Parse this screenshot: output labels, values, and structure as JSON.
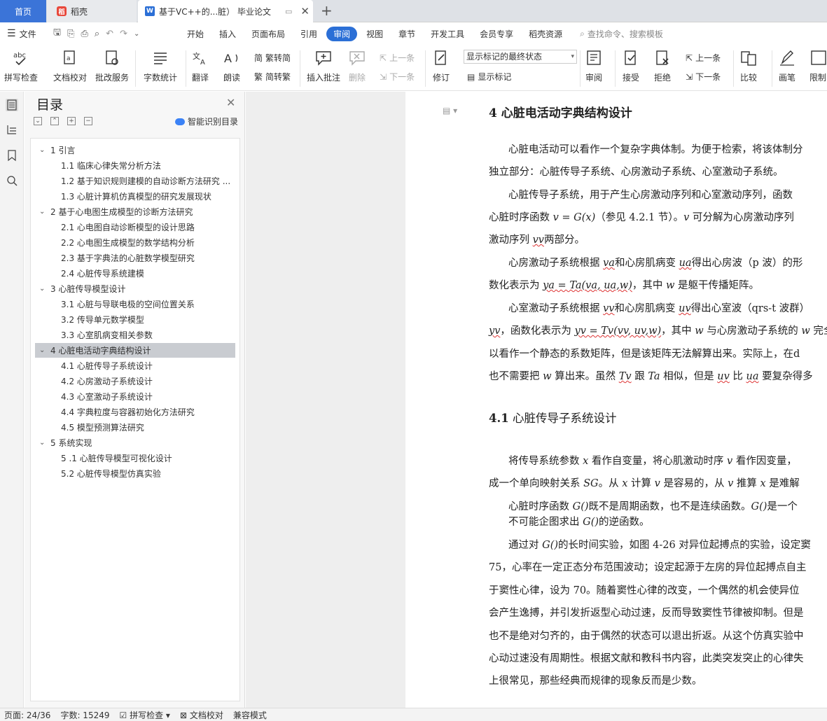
{
  "tabs": {
    "home": "首页",
    "daoke": "稻壳",
    "doc": "基于VC++的...脏） 毕业论文"
  },
  "menu": {
    "file": "文件",
    "items": [
      "开始",
      "插入",
      "页面布局",
      "引用",
      "审阅",
      "视图",
      "章节",
      "开发工具",
      "会员专享",
      "稻壳资源"
    ],
    "active_index": 4,
    "search": "查找命令、搜索模板"
  },
  "ribbon": {
    "spell": "拼写检查",
    "doc_check": "文档校对",
    "revise_service": "批改服务",
    "word_count": "字数统计",
    "translate": "翻译",
    "read": "朗读",
    "trad": "繁转简",
    "simp": "简转繁",
    "insert_comment": "插入批注",
    "delete": "删除",
    "prev_comment": "上一条",
    "next_comment": "下一条",
    "track": "修订",
    "show_mode": "显示标记的最终状态",
    "show_marks": "显示标记",
    "review": "审阅",
    "accept": "接受",
    "reject": "拒绝",
    "prev_change": "上一条",
    "next_change": "下一条",
    "compare": "比较",
    "pen": "画笔",
    "restrict": "限制"
  },
  "toc": {
    "title": "目录",
    "smart": "智能识别目录",
    "items": [
      {
        "label": "1 引言",
        "level": 1
      },
      {
        "label": "1.1 临床心律失常分析方法",
        "level": 2
      },
      {
        "label": "1.2 基于知识规则建模的自动诊断方法研究 ...",
        "level": 2
      },
      {
        "label": "1.3 心脏计算机仿真模型的研究发展现状",
        "level": 2
      },
      {
        "label": "2 基于心电图生成模型的诊断方法研究",
        "level": 1
      },
      {
        "label": "2.1 心电图自动诊断模型的设计思路",
        "level": 2
      },
      {
        "label": "2.2 心电图生成模型的数学结构分析",
        "level": 2
      },
      {
        "label": "2.3 基于字典法的心脏数学模型研究",
        "level": 2
      },
      {
        "label": "2.4 心脏传导系统建模",
        "level": 2
      },
      {
        "label": "3 心脏传导模型设计",
        "level": 1
      },
      {
        "label": "3.1 心脏与导联电极的空间位置关系",
        "level": 2
      },
      {
        "label": "3.2 传导单元数学模型",
        "level": 2
      },
      {
        "label": "3.3 心室肌病变相关参数",
        "level": 2
      },
      {
        "label": "4 心脏电活动字典结构设计",
        "level": 1,
        "selected": true
      },
      {
        "label": "4.1 心脏传导子系统设计",
        "level": 2
      },
      {
        "label": "4.2 心房激动子系统设计",
        "level": 2
      },
      {
        "label": "4.3 心室激动子系统设计",
        "level": 2
      },
      {
        "label": "4.4 字典粒度与容器初始化方法研究",
        "level": 2
      },
      {
        "label": "4.5 模型预测算法研究",
        "level": 2
      },
      {
        "label": "5 系统实现",
        "level": 1
      },
      {
        "label": "5 .1 心脏传导模型可视化设计",
        "level": 2
      },
      {
        "label": "5.2 心脏传导模型仿真实验",
        "level": 2
      }
    ]
  },
  "doc": {
    "h1": "4 心脏电活动字典结构设计",
    "p1a": "心脏电活动可以看作一个复杂字典体制。为便于检索，将该体制分",
    "p1b": "独立部分：心脏传导子系统、心房激动子系统、心室激动子系统。",
    "p2a": "心脏传导子系统，用于产生心房激动序列和心室激动序列，函数",
    "p2b_1": "心脏时序函数 ",
    "p2b_2": "v = G(x)",
    "p2b_3": "（参见 4.2.1 节）。",
    "p2b_4": "v",
    "p2b_5": " 可分解为心房激动序列",
    "p2c_1": "激动序列 ",
    "p2c_2": "vv",
    "p2c_3": "两部分。",
    "p3a_1": "心房激动子系统根据 ",
    "p3a_2": "va",
    "p3a_3": "和心房肌病变 ",
    "p3a_4": "ua",
    "p3a_5": "得出心房波（p 波）的形",
    "p3b_1": "数化表示为 ",
    "p3b_2": "ya = Ta(va, ua,w)",
    "p3b_3": "，其中 ",
    "p3b_4": "w",
    "p3b_5": " 是躯干传播矩阵。",
    "p4a_1": "心室激动子系统根据 ",
    "p4a_2": "vv",
    "p4a_3": "和心房肌病变 ",
    "p4a_4": "uv",
    "p4a_5": "得出心室波（qrs-t 波群）",
    "p4b_1": "yv",
    "p4b_2": "，函数化表示为 ",
    "p4b_3": "yv = Tv(vv, uv,w)",
    "p4b_4": "，其中 ",
    "p4b_5": "w",
    "p4b_6": " 与心房激动子系统的 ",
    "p4b_7": "w",
    "p4b_8": " 完全",
    "p4c": "以看作一个静态的系数矩阵，但是该矩阵无法解算出来。实际上，在d",
    "p4d_1": "也不需要把 ",
    "p4d_2": "w",
    "p4d_3": " 算出来。虽然 ",
    "p4d_4": "Tv",
    "p4d_5": " 跟 ",
    "p4d_6": "Ta",
    "p4d_7": " 相似，但是 ",
    "p4d_8": "uv",
    "p4d_9": " 比 ",
    "p4d_10": "ua",
    "p4d_11": " 要复杂得多",
    "h2_num": "4.1",
    "h2_text": " 心脏传导子系统设计",
    "p5a_1": "将传导系统参数 ",
    "p5a_2": "x",
    "p5a_3": " 看作自变量，将心肌激动时序 ",
    "p5a_4": "v",
    "p5a_5": " 看作因变量，",
    "p5b_1": "成一个单向映射关系 ",
    "p5b_2": "SG",
    "p5b_3": "。从 ",
    "p5b_4": "x",
    "p5b_5": " 计算 ",
    "p5b_6": "v",
    "p5b_7": " 是容易的，从 ",
    "p5b_8": "v",
    "p5b_9": " 推算 ",
    "p5b_10": "x",
    "p5b_11": " 是难解",
    "p6a_1": "心脏时序函数 ",
    "p6a_2": "G()",
    "p6a_3": "既不是周期函数，也不是连续函数。",
    "p6a_4": "G()",
    "p6a_5": "是一个",
    "p6b_1": "不可能企图求出 ",
    "p6b_2": "G()",
    "p6b_3": "的逆函数。",
    "p7a_1": "通过对 ",
    "p7a_2": "G()",
    "p7a_3": "的长时间实验，如图 4-26 对异位起搏点的实验，设定窦",
    "p7b": "75，心率在一定正态分布范围波动；设定起源于左房的异位起搏点自主",
    "p7c": "于窦性心律，设为 70。随着窦性心律的改变，一个偶然的机会使异位",
    "p7d": "会产生逸搏，并引发折返型心动过速，反而导致窦性节律被抑制。但是",
    "p7e": "也不是绝对匀齐的，由于偶然的状态可以退出折返。从这个仿真实验中",
    "p7f": "心动过速没有周期性。根据文献和教科书内容，此类突发突止的心律失",
    "p7g": "上很常见，那些经典而规律的现象反而是少数。"
  },
  "status": {
    "page": "页面: 24/36",
    "words": "字数: 15249",
    "spell": "拼写检查",
    "check": "文档校对",
    "compat": "兼容模式"
  }
}
